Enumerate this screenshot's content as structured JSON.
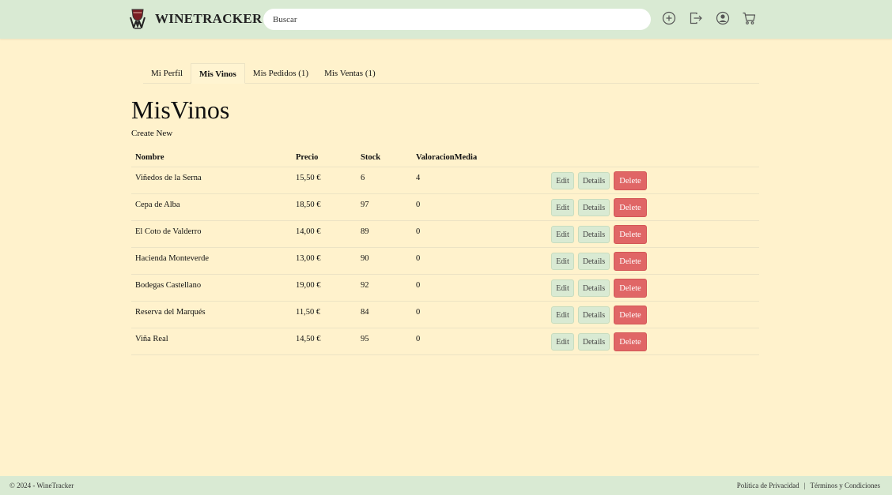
{
  "header": {
    "brand": "WINETRACKER",
    "search_placeholder": "Buscar",
    "icons": [
      "plus-circle-icon",
      "logout-icon",
      "user-icon",
      "cart-icon"
    ]
  },
  "tabs": [
    {
      "label": "Mi Perfil",
      "active": false
    },
    {
      "label": "Mis Vinos",
      "active": true
    },
    {
      "label": "Mis Pedidos (1)",
      "active": false
    },
    {
      "label": "Mis Ventas (1)",
      "active": false
    }
  ],
  "page": {
    "title": "MisVinos",
    "create_link": "Create New"
  },
  "table": {
    "columns": [
      "Nombre",
      "Precio",
      "Stock",
      "ValoracionMedia"
    ],
    "actions": {
      "edit": "Edit",
      "details": "Details",
      "delete": "Delete"
    },
    "rows": [
      {
        "nombre": "Viñedos de la Serna",
        "precio": "15,50 €",
        "stock": "6",
        "valoracion": "4"
      },
      {
        "nombre": "Cepa de Alba",
        "precio": "18,50 €",
        "stock": "97",
        "valoracion": "0"
      },
      {
        "nombre": "El Coto de Valderro",
        "precio": "14,00 €",
        "stock": "89",
        "valoracion": "0"
      },
      {
        "nombre": "Hacienda Monteverde",
        "precio": "13,00 €",
        "stock": "90",
        "valoracion": "0"
      },
      {
        "nombre": "Bodegas Castellano",
        "precio": "19,00 €",
        "stock": "92",
        "valoracion": "0"
      },
      {
        "nombre": "Reserva del Marqués",
        "precio": "11,50 €",
        "stock": "84",
        "valoracion": "0"
      },
      {
        "nombre": "Viña Real",
        "precio": "14,50 €",
        "stock": "95",
        "valoracion": "0"
      }
    ]
  },
  "footer": {
    "copyright": "© 2024 - WineTracker",
    "privacy": "Política de Privacidad",
    "separator": "|",
    "terms": "Términos y Condiciones"
  },
  "colors": {
    "background": "#fff2cc",
    "header": "#d9ead3",
    "delete": "#e06666"
  }
}
